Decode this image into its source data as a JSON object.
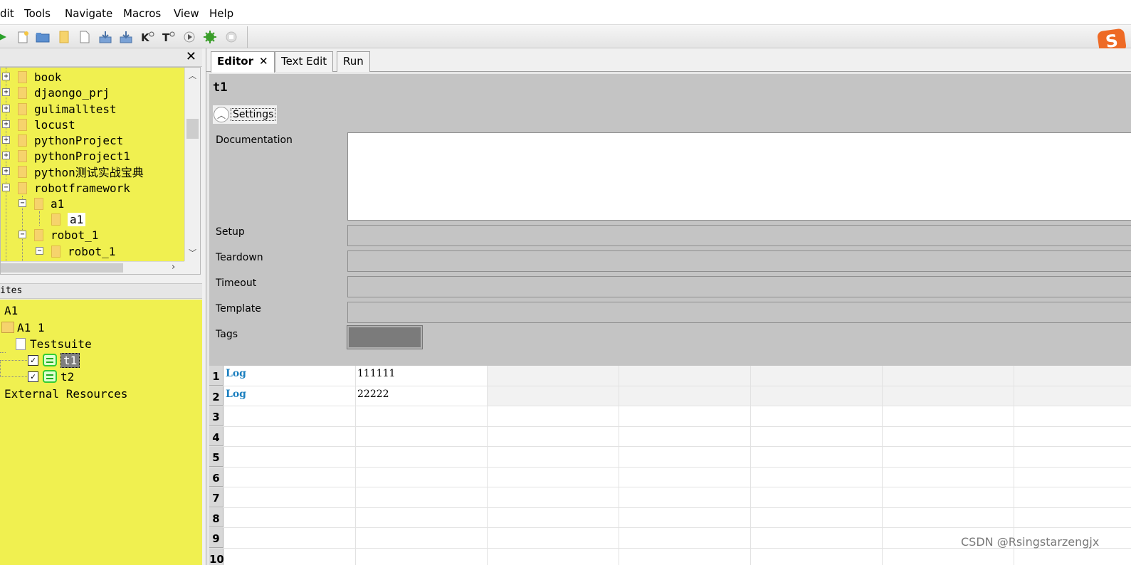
{
  "menubar": {
    "items": [
      "dit",
      "Tools",
      "Navigate",
      "Macros",
      "View",
      "Help"
    ]
  },
  "toolbar": {
    "icons": [
      "run-icon",
      "new-project-icon",
      "open-icon",
      "open-directory-icon",
      "new-file-icon",
      "save-icon",
      "save-all-icon",
      "search-keyword-icon",
      "search-test-icon",
      "run-tests-icon",
      "debug-icon",
      "stop-icon"
    ],
    "brand_letter": "S"
  },
  "tree": {
    "close": "✕",
    "items": [
      {
        "label": "book",
        "expander": "+"
      },
      {
        "label": "djaongo_prj",
        "expander": "+"
      },
      {
        "label": "gulimalltest",
        "expander": "+"
      },
      {
        "label": "locust",
        "expander": "+"
      },
      {
        "label": "pythonProject",
        "expander": "+"
      },
      {
        "label": "pythonProject1",
        "expander": "+"
      },
      {
        "label": "python测试实战宝典",
        "expander": "+"
      },
      {
        "label": "robotframework",
        "expander": "−"
      },
      {
        "label": "a1",
        "expander": "−"
      },
      {
        "label": "a1",
        "expander": ""
      },
      {
        "label": "robot_1",
        "expander": "−"
      },
      {
        "label": "robot_1",
        "expander": "−"
      }
    ]
  },
  "suites": {
    "header": "ites",
    "items": [
      {
        "label": "A1"
      },
      {
        "label": "A1 1"
      },
      {
        "label": "Testsuite"
      },
      {
        "label": "t1",
        "checked": "✓"
      },
      {
        "label": "t2",
        "checked": "✓"
      },
      {
        "label": "External Resources"
      }
    ]
  },
  "tabs": [
    {
      "label": "Editor",
      "close": "✕"
    },
    {
      "label": "Text Edit"
    },
    {
      "label": "Run"
    }
  ],
  "editor": {
    "title": "t1",
    "settings_label": "Settings",
    "settings_icon": "chevron-up-icon",
    "fields": {
      "documentation": "Documentation",
      "setup": "Setup",
      "teardown": "Teardown",
      "timeout": "Timeout",
      "template": "Template",
      "tags": "Tags"
    }
  },
  "grid": {
    "row_numbers": [
      "1",
      "2",
      "3",
      "4",
      "5",
      "6",
      "7",
      "8",
      "9",
      "10"
    ],
    "rows": [
      [
        "Log",
        "111111"
      ],
      [
        "Log",
        "22222"
      ]
    ]
  },
  "colors": {
    "tree_background": "#f0f050",
    "keyword": "#1b7fbf",
    "brand": "#ee6a25"
  },
  "watermark": "CSDN @Rsingstarzengjx"
}
